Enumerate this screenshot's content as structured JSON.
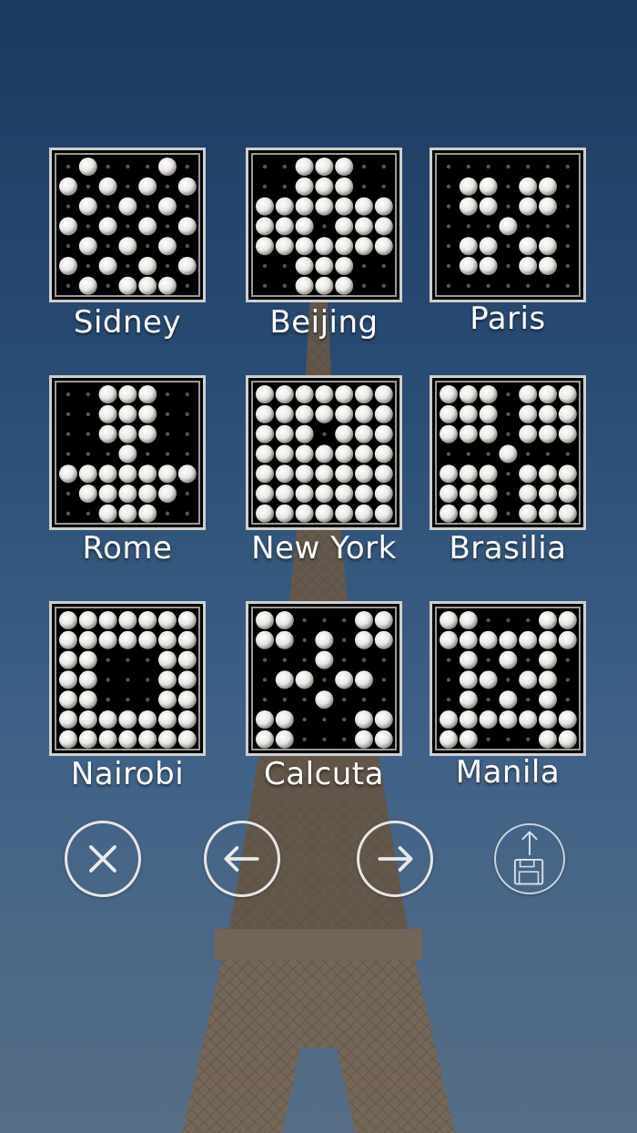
{
  "boards": [
    {
      "id": "sidney",
      "name": "Sidney",
      "grid": [
        "0100010",
        "1010101",
        "0101010",
        "1010101",
        "0101010",
        "1010101",
        "0101110"
      ]
    },
    {
      "id": "beijing",
      "name": "Beijing",
      "grid": [
        "0011100",
        "0011100",
        "1111111",
        "1110111",
        "1111111",
        "0011100",
        "0011100"
      ]
    },
    {
      "id": "paris",
      "name": "Paris",
      "grid": [
        "0000000",
        "0110110",
        "0110110",
        "0001000",
        "0110110",
        "0110110",
        "0000000"
      ]
    },
    {
      "id": "rome",
      "name": "Rome",
      "grid": [
        "0011100",
        "0011100",
        "0011100",
        "0001000",
        "1111111",
        "0111110",
        "0011100"
      ]
    },
    {
      "id": "newyork",
      "name": "New York",
      "grid": [
        "1111111",
        "1111111",
        "1110111",
        "1111111",
        "1111111",
        "1111111",
        "1111111"
      ]
    },
    {
      "id": "brasilia",
      "name": "Brasilia",
      "grid": [
        "1110111",
        "1110111",
        "1110111",
        "0001000",
        "1110111",
        "1110111",
        "1110111"
      ]
    },
    {
      "id": "nairobi",
      "name": "Nairobi",
      "grid": [
        "1111111",
        "1111111",
        "1100011",
        "1100011",
        "1100011",
        "1111111",
        "1111111"
      ]
    },
    {
      "id": "calcuta",
      "name": "Calcuta",
      "grid": [
        "1100011",
        "1101011",
        "0001000",
        "0110110",
        "0001000",
        "1100011",
        "1100011"
      ]
    },
    {
      "id": "manila",
      "name": "Manila",
      "grid": [
        "1100011",
        "1111111",
        "0101010",
        "0110110",
        "0101010",
        "1111111",
        "1100011"
      ]
    }
  ],
  "controls": {
    "close_icon": "close-x-icon",
    "prev_icon": "arrow-left-icon",
    "next_icon": "arrow-right-icon",
    "save_icon": "floppy-upload-icon"
  },
  "colors": {
    "peg": "#e8e6e2",
    "hole": "#555555",
    "board": "#000000",
    "frame": "#cfcfcf"
  }
}
